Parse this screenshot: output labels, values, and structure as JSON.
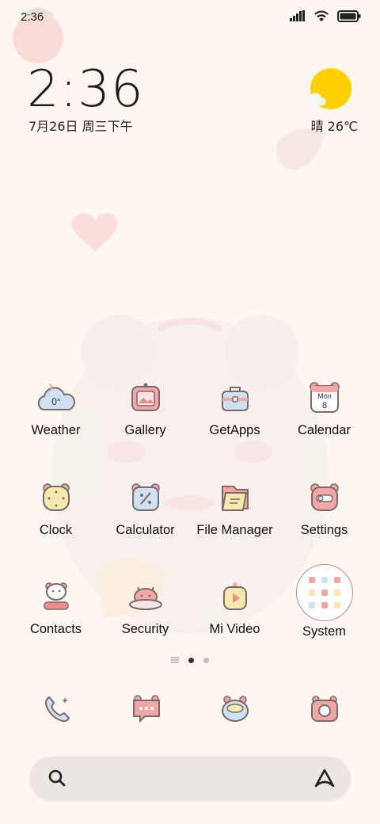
{
  "status_bar": {
    "time": "2:36",
    "icons": [
      "signal-icon",
      "wifi-icon",
      "battery-icon"
    ]
  },
  "clock_widget": {
    "time": "2:36",
    "date": "7月26日 周三下午"
  },
  "weather_widget": {
    "text": "晴 26℃",
    "icon": "sunny-cloud-icon"
  },
  "apps": [
    {
      "label": "Weather",
      "icon": "weather-icon",
      "icon_text": "0°"
    },
    {
      "label": "Gallery",
      "icon": "gallery-icon"
    },
    {
      "label": "GetApps",
      "icon": "getapps-icon"
    },
    {
      "label": "Calendar",
      "icon": "calendar-icon",
      "icon_text": "Mon",
      "icon_text2": "8"
    },
    {
      "label": "Clock",
      "icon": "clock-icon"
    },
    {
      "label": "Calculator",
      "icon": "calculator-icon"
    },
    {
      "label": "File Manager",
      "icon": "file-manager-icon"
    },
    {
      "label": "Settings",
      "icon": "settings-icon"
    },
    {
      "label": "Contacts",
      "icon": "contacts-icon"
    },
    {
      "label": "Security",
      "icon": "security-icon"
    },
    {
      "label": "Mi Video",
      "icon": "mi-video-icon"
    },
    {
      "label": "System",
      "icon": "system-folder-icon"
    }
  ],
  "page_indicator": {
    "pages": 2,
    "current": 1
  },
  "dock": [
    "phone-icon",
    "messages-icon",
    "browser-icon",
    "camera-icon"
  ],
  "search_bar": {
    "left_icon": "search-icon",
    "right_icon": "assistant-icon"
  },
  "colors": {
    "background": "#fdf6f1",
    "sun": "#ffd000",
    "icon_pink": "#f2a7a7",
    "icon_blue": "#cfe0f0",
    "icon_yellow": "#f7e8b0",
    "outline": "#7a6a6a"
  }
}
